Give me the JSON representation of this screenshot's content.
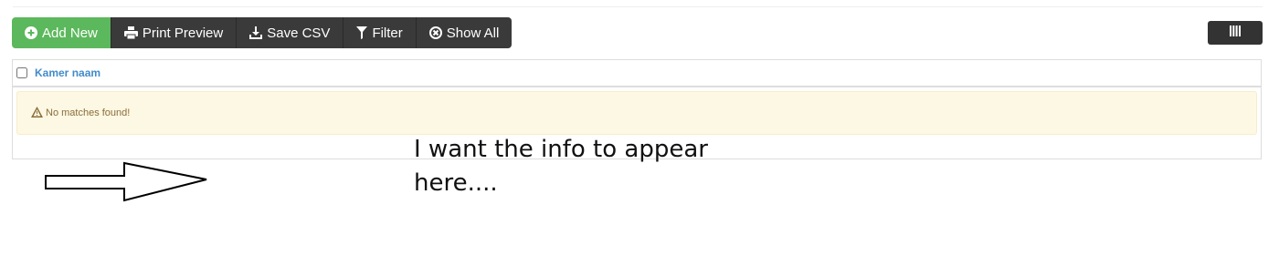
{
  "toolbar": {
    "add_new": "Add New",
    "print_preview": "Print Preview",
    "save_csv": "Save CSV",
    "filter": "Filter",
    "show_all": "Show All"
  },
  "grid": {
    "columns": [
      "Kamer naam"
    ],
    "empty_message": "No matches found!"
  },
  "annotation": {
    "note_line1": "I want the info to appear",
    "note_line2": "here...."
  },
  "icons": {
    "add_new": "plus-circle-icon",
    "print_preview": "printer-icon",
    "save_csv": "download-icon",
    "filter": "filter-icon",
    "show_all": "close-circle-icon",
    "column_toggle": "columns-icon",
    "alert": "warning-icon",
    "annotation": "arrow-right-icon"
  },
  "colors": {
    "add_new_bg": "#5cb85c",
    "toolbar_bg": "#3a3a3a",
    "header_text": "#428bca",
    "alert_bg": "#fcf8e3",
    "alert_text": "#8a6d3b"
  }
}
